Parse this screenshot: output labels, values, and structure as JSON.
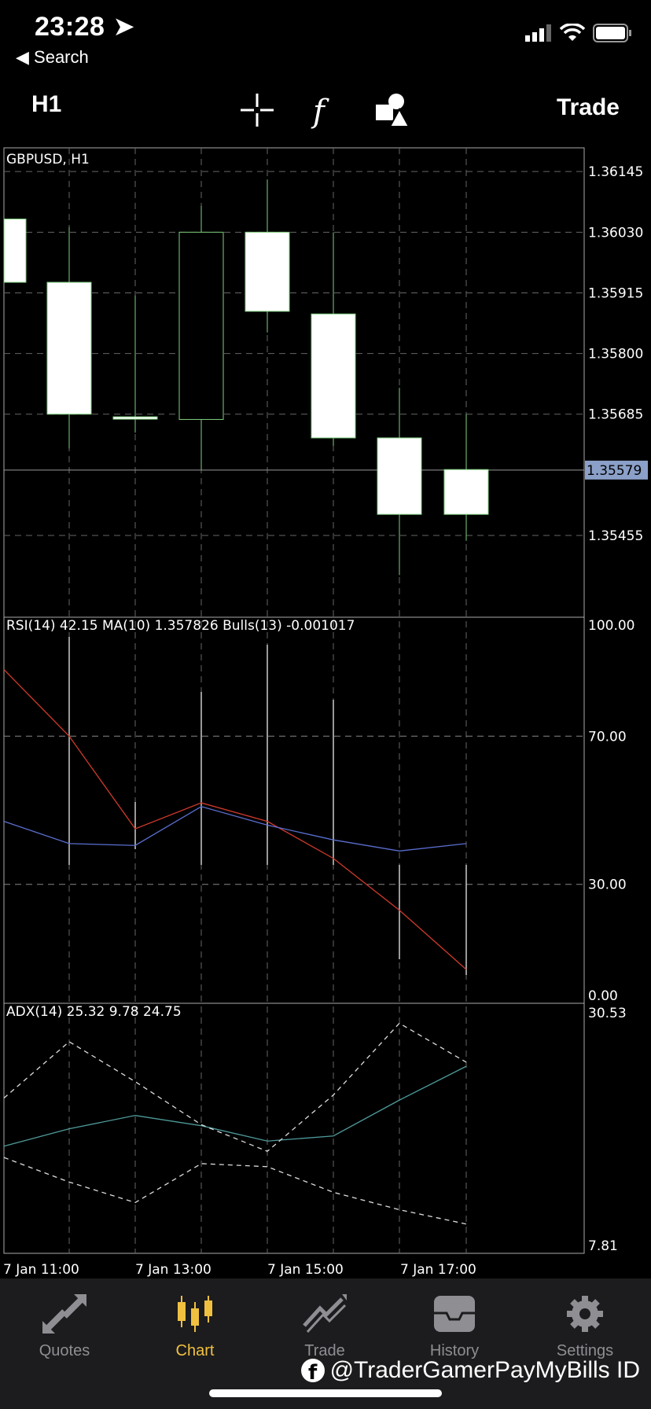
{
  "status": {
    "time": "23:28",
    "back": "◀ Search"
  },
  "toolbar": {
    "timeframe": "H1",
    "trade": "Trade"
  },
  "chart": {
    "symbol_label": "GBPUSD, H1",
    "price_ticks": [
      "1.36145",
      "1.36030",
      "1.35915",
      "1.35800",
      "1.35685",
      "1.35455"
    ],
    "current_price": "1.35579",
    "rsi_label": "RSI(14) 42.15 MA(10) 1.357826 Bulls(13) -0.001017",
    "rsi_ticks": [
      "100.00",
      "70.00",
      "30.00",
      "0.00"
    ],
    "adx_label": "ADX(14) 25.32 9.78 24.75",
    "adx_ticks": [
      "30.53",
      "7.81"
    ],
    "time_ticks": [
      "7 Jan 11:00",
      "7 Jan 13:00",
      "7 Jan 15:00",
      "7 Jan 17:00"
    ]
  },
  "chart_data": {
    "type": "candlestick",
    "title": "GBPUSD, H1",
    "price_range": [
      1.353,
      1.3619
    ],
    "candles": [
      {
        "open": 1.36055,
        "close": 1.35935,
        "high": 1.36055,
        "low": 1.35935
      },
      {
        "open": 1.35935,
        "close": 1.35685,
        "high": 1.3604,
        "low": 1.3562
      },
      {
        "open": 1.3568,
        "close": 1.3568,
        "high": 1.3591,
        "low": 1.3565
      },
      {
        "open": 1.35675,
        "close": 1.3603,
        "high": 1.3608,
        "low": 1.3558
      },
      {
        "open": 1.3603,
        "close": 1.3588,
        "high": 1.3613,
        "low": 1.3584
      },
      {
        "open": 1.35875,
        "close": 1.3564,
        "high": 1.3603,
        "low": 1.35625
      },
      {
        "open": 1.3564,
        "close": 1.35495,
        "high": 1.35735,
        "low": 1.3538
      },
      {
        "open": 1.3558,
        "close": 1.35495,
        "high": 1.35685,
        "low": 1.35445
      }
    ],
    "rsi_panel": {
      "ylim": [
        0,
        100
      ],
      "series": [
        {
          "color": "#d03a2c",
          "values": [
            88,
            70,
            45,
            52,
            47,
            37,
            23,
            7
          ]
        },
        {
          "color": "#5a6fd0",
          "values": [
            47,
            41,
            40.5,
            51,
            46,
            42,
            39,
            41
          ]
        }
      ]
    },
    "adx_panel": {
      "ylim": [
        7.81,
        30.53
      ],
      "series": [
        {
          "color": "#4f9a9a",
          "values": [
            17.5,
            19.2,
            20.5,
            19.5,
            18.0,
            18.5,
            22.0,
            25.3
          ]
        },
        {
          "color": "#dddddd",
          "dashed": true,
          "values": [
            22.2,
            27.7,
            23.8,
            19.6,
            17.0,
            22.5,
            29.5,
            25.7
          ]
        },
        {
          "color": "#dddddd",
          "dashed": true,
          "values": [
            16.4,
            14.0,
            12.0,
            15.8,
            15.5,
            13.0,
            11.3,
            9.9
          ]
        }
      ]
    }
  },
  "tabs": [
    {
      "label": "Quotes",
      "icon": "quotes-icon"
    },
    {
      "label": "Chart",
      "icon": "chart-icon"
    },
    {
      "label": "Trade",
      "icon": "trade-icon"
    },
    {
      "label": "History",
      "icon": "history-icon"
    },
    {
      "label": "Settings",
      "icon": "settings-icon"
    }
  ],
  "watermark": "@TraderGamerPayMyBills ID"
}
